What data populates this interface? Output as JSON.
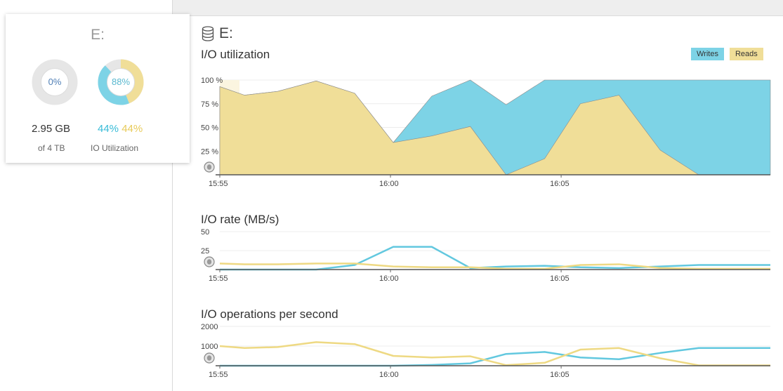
{
  "colors": {
    "writes": "#7dd3e6",
    "reads": "#f0de98",
    "writes_line": "#62c8df",
    "reads_line": "#eed983"
  },
  "summary_card": {
    "title": "E:",
    "disk_donut": {
      "label": "0%",
      "value": 0
    },
    "io_donut": {
      "label": "88%",
      "writes": 44,
      "reads": 44
    },
    "used": "2.95 GB",
    "total": "of 4 TB",
    "io_writes": "44%",
    "io_reads": "44%",
    "io_label": "IO Utilization"
  },
  "main": {
    "drive_label": "E:",
    "drive_icon": "database-icon"
  },
  "legend": {
    "writes": "Writes",
    "reads": "Reads"
  },
  "chart_data": [
    {
      "type": "area",
      "title": "I/O utilization",
      "ylim": [
        0,
        100
      ],
      "yticks": [
        "100 %",
        "75 %",
        "50 %",
        "25 %"
      ],
      "x_ticks": [
        "15:55",
        "16:00",
        "16:05"
      ],
      "x_tick_pos": [
        0,
        0.31,
        0.62
      ],
      "x": [
        0,
        0.045,
        0.105,
        0.175,
        0.245,
        0.315,
        0.385,
        0.455,
        0.52,
        0.59,
        0.655,
        0.725,
        0.8,
        0.87,
        1.0
      ],
      "series": [
        {
          "name": "Writes",
          "values": [
            0,
            0,
            0,
            0,
            0,
            0,
            42,
            66,
            74,
            100,
            100,
            100,
            100,
            100,
            100
          ]
        },
        {
          "name": "Reads",
          "values": [
            93,
            84,
            88,
            99,
            86,
            34,
            41,
            51,
            0,
            17,
            75,
            84,
            26,
            0,
            0
          ]
        }
      ]
    },
    {
      "type": "line",
      "title": "I/O rate (MB/s)",
      "ylim": [
        0,
        50
      ],
      "yticks": [
        "50",
        "25"
      ],
      "x_ticks": [
        "15:55",
        "16:00",
        "16:05"
      ],
      "x_tick_pos": [
        0,
        0.31,
        0.62
      ],
      "x": [
        0,
        0.045,
        0.105,
        0.175,
        0.245,
        0.315,
        0.385,
        0.455,
        0.52,
        0.59,
        0.655,
        0.725,
        0.8,
        0.87,
        1.0
      ],
      "series": [
        {
          "name": "Writes",
          "values": [
            0,
            0,
            0,
            0,
            6,
            30,
            30,
            2,
            4,
            5,
            3,
            2,
            4,
            6,
            6
          ]
        },
        {
          "name": "Reads",
          "values": [
            8,
            7,
            7,
            8,
            8,
            4,
            3,
            3,
            1,
            1,
            6,
            7,
            2,
            1,
            1
          ]
        }
      ]
    },
    {
      "type": "line",
      "title": "I/O operations per second",
      "ylim": [
        0,
        2000
      ],
      "yticks": [
        "2000",
        "1000"
      ],
      "x_ticks": [
        "15:55",
        "16:00",
        "16:05"
      ],
      "x_tick_pos": [
        0,
        0.31,
        0.62
      ],
      "x": [
        0,
        0.045,
        0.105,
        0.175,
        0.245,
        0.315,
        0.385,
        0.455,
        0.52,
        0.59,
        0.655,
        0.725,
        0.8,
        0.87,
        1.0
      ],
      "series": [
        {
          "name": "Writes",
          "values": [
            0,
            0,
            0,
            0,
            0,
            0,
            40,
            120,
            600,
            700,
            420,
            330,
            650,
            900,
            900
          ]
        },
        {
          "name": "Reads",
          "values": [
            1000,
            900,
            950,
            1200,
            1100,
            500,
            420,
            480,
            30,
            150,
            820,
            900,
            380,
            20,
            20
          ]
        }
      ]
    }
  ]
}
